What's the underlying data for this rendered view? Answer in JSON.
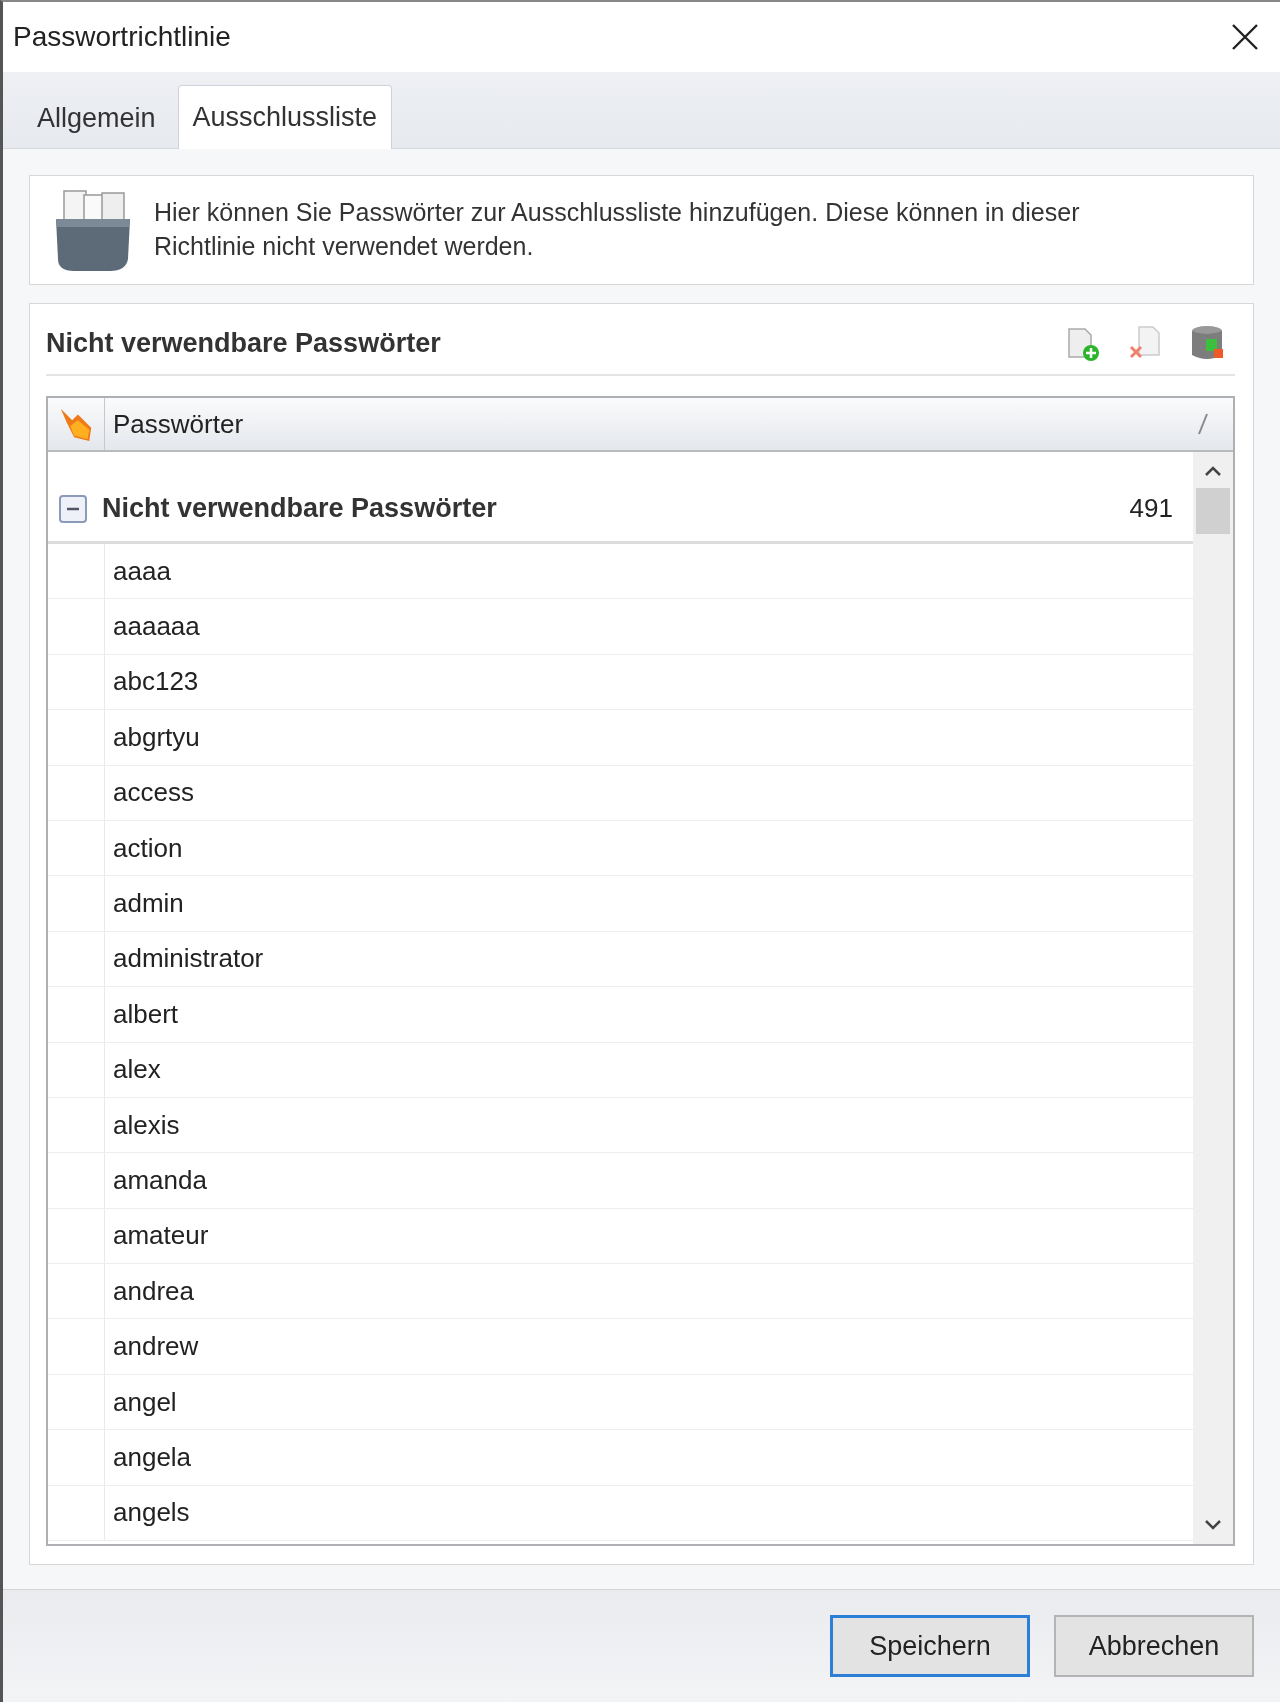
{
  "window": {
    "title": "Passwortrichtlinie"
  },
  "tabs": [
    {
      "label": "Allgemein",
      "selected": false
    },
    {
      "label": "Ausschlussliste",
      "selected": true
    }
  ],
  "info": {
    "text": "Hier können Sie Passwörter zur Ausschlussliste hinzufügen. Diese können in dieser Richtlinie nicht verwendet werden."
  },
  "panel": {
    "title": "Nicht verwendbare Passwörter",
    "table": {
      "columns": [
        "Passwörter"
      ],
      "group": {
        "label": "Nicht verwendbare Passwörter",
        "count": "491",
        "expanded": true
      },
      "rows": [
        "aaaa",
        "aaaaaa",
        "abc123",
        "abgrtyu",
        "access",
        "action",
        "admin",
        "administrator",
        "albert",
        "alex",
        "alexis",
        "amanda",
        "amateur",
        "andrea",
        "andrew",
        "angel",
        "angela",
        "angels"
      ]
    }
  },
  "buttons": [
    {
      "label": "Speichern",
      "default": true
    },
    {
      "label": "Abbrechen",
      "default": false
    }
  ]
}
